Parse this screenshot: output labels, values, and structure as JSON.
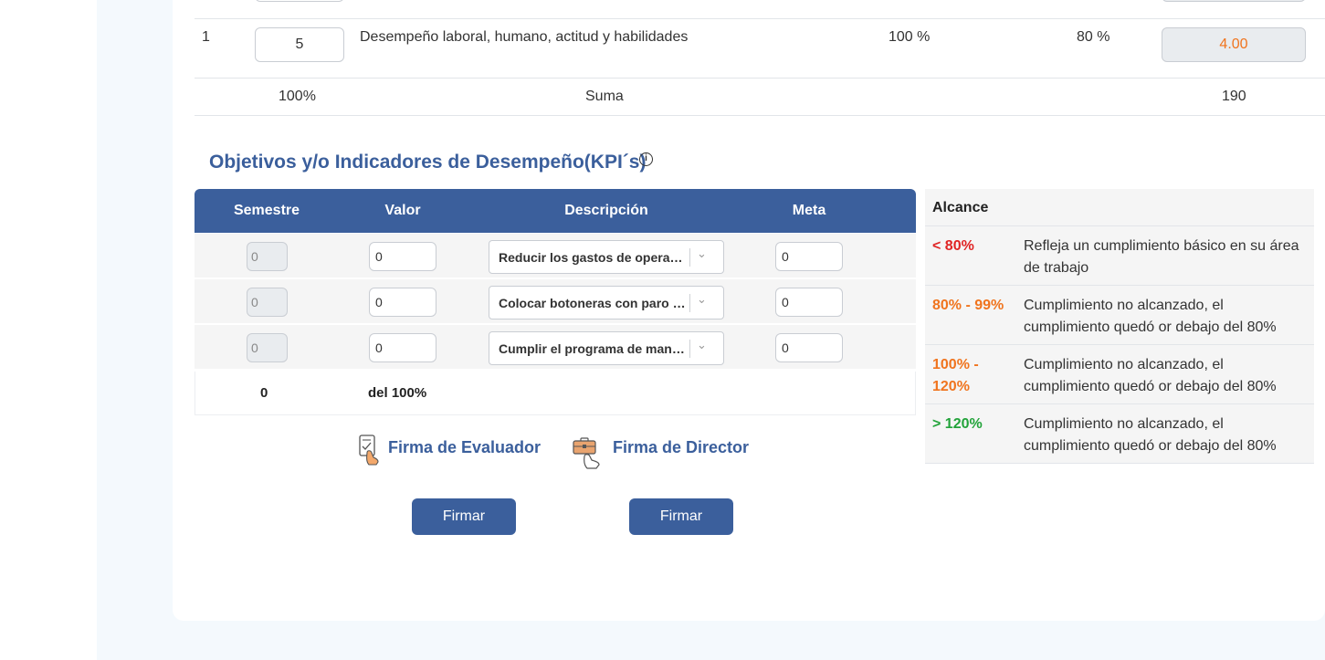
{
  "eval_table": {
    "row": {
      "index": "1",
      "value": "5",
      "description": "Desempeño laboral, humano, actitud y habilidades",
      "weight": "100 %",
      "percent": "80 %",
      "result": "4.00"
    },
    "footer": {
      "total_percent": "100%",
      "label": "Suma",
      "total": "190"
    }
  },
  "kpi": {
    "title": "Objetivos y/o Indicadores de Desempeño(KPI´s)",
    "info_icon": "info-icon",
    "headers": {
      "semestre": "Semestre",
      "valor": "Valor",
      "descripcion": "Descripción",
      "meta": "Meta"
    },
    "rows": [
      {
        "semestre": "0",
        "valor": "0",
        "descripcion": "Reducir los gastos de operación",
        "meta": "0"
      },
      {
        "semestre": "0",
        "valor": "0",
        "descripcion": "Colocar botoneras con paro de emergencia",
        "meta": "0"
      },
      {
        "semestre": "0",
        "valor": "0",
        "descripcion": "Cumplir el programa de mantenimiento",
        "meta": "0"
      }
    ],
    "footer": {
      "total": "0",
      "label": "del 100%"
    }
  },
  "alcance": {
    "title": "Alcance",
    "rows": [
      {
        "range": "< 80%",
        "color": "#e02424",
        "desc": "Refleja un cumplimiento básico en su área de trabajo"
      },
      {
        "range": "80% - 99%",
        "color": "#f0741e",
        "desc": "Cumplimiento no alcanzado, el cumplimiento quedó or debajo del 80%"
      },
      {
        "range": "100% - 120%",
        "color": "#f0741e",
        "desc": "Cumplimiento no alcanzado, el cumplimiento quedó or debajo del 80%"
      },
      {
        "range": "> 120%",
        "color": "#22a33a",
        "desc": "Cumplimiento no alcanzado, el cumplimiento quedó or debajo del 80%"
      }
    ]
  },
  "signatures": {
    "evaluator": {
      "label": "Firma de Evaluador",
      "icon": "signed-document-icon",
      "button": "Firmar"
    },
    "director": {
      "label": "Firma de Director",
      "icon": "briefcase-hand-icon",
      "button": "Firmar"
    }
  },
  "colors": {
    "primary": "#3b5f9c",
    "orange": "#f0741e",
    "red": "#e02424",
    "green": "#22a33a"
  }
}
